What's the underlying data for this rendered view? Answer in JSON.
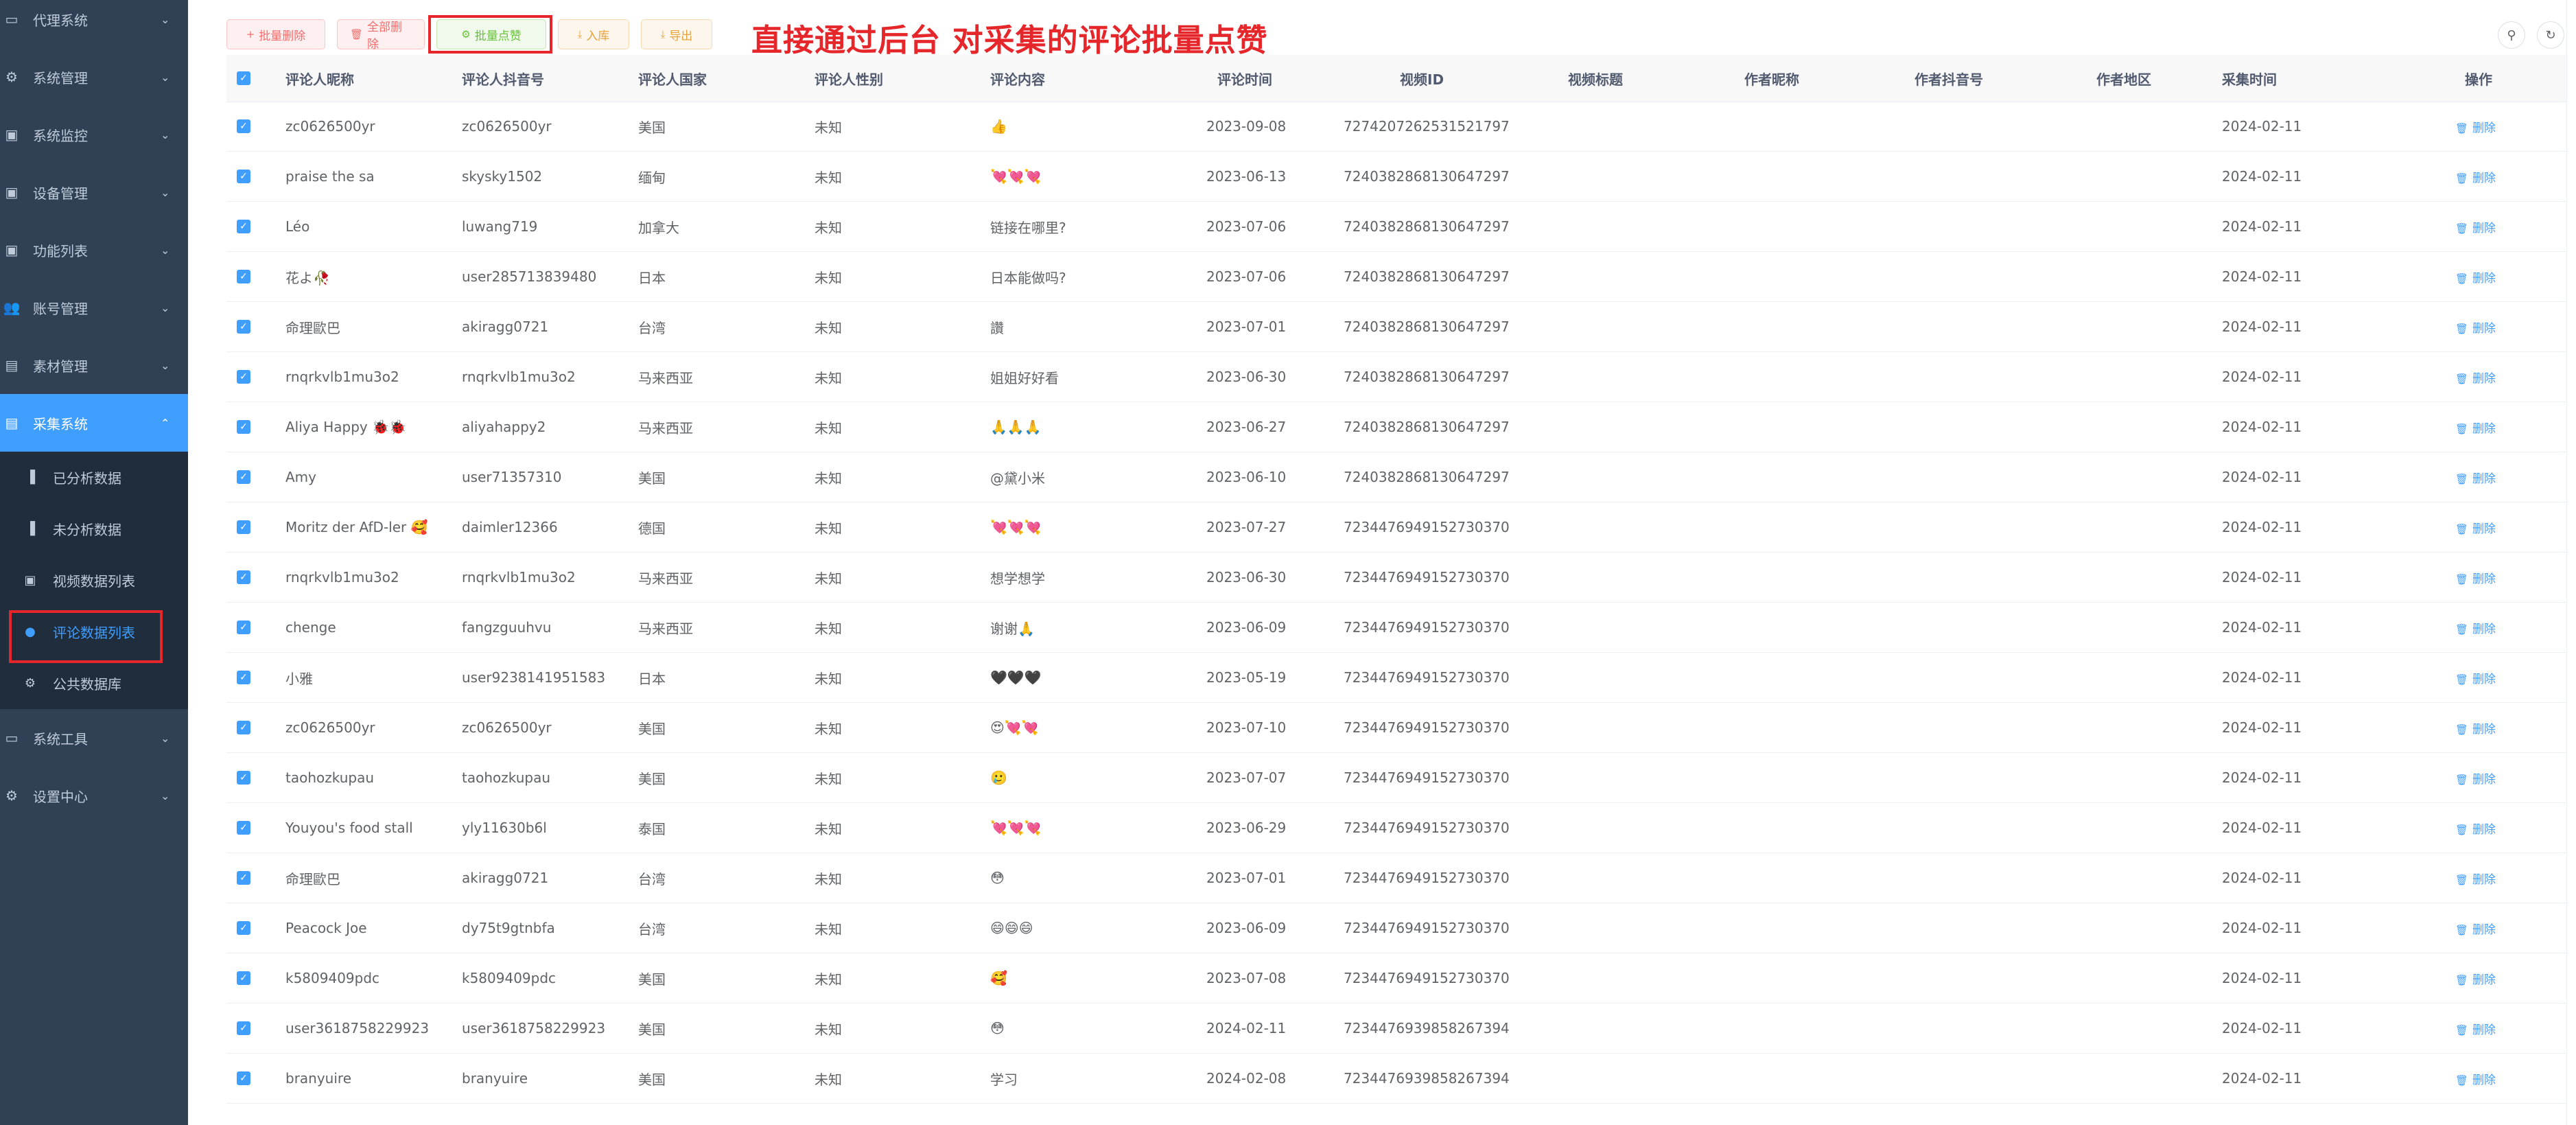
{
  "sidebar": {
    "menu": [
      {
        "label": "代理系统",
        "icon": "folder-icon",
        "glyph": "▭"
      },
      {
        "label": "系统管理",
        "icon": "gear-icon",
        "glyph": "⚙"
      },
      {
        "label": "系统监控",
        "icon": "monitor-icon",
        "glyph": "▣"
      },
      {
        "label": "设备管理",
        "icon": "monitor-icon",
        "glyph": "▣"
      },
      {
        "label": "功能列表",
        "icon": "monitor-icon",
        "glyph": "▣"
      },
      {
        "label": "账号管理",
        "icon": "users-icon",
        "glyph": "👥"
      },
      {
        "label": "素材管理",
        "icon": "document-icon",
        "glyph": "▤"
      },
      {
        "label": "采集系统",
        "icon": "document-icon",
        "glyph": "▤"
      }
    ],
    "submenu": [
      {
        "label": "已分析数据",
        "icon": "bar-chart-icon",
        "glyph": "▐"
      },
      {
        "label": "未分析数据",
        "icon": "bar-chart-icon",
        "glyph": "▐"
      },
      {
        "label": "视频数据列表",
        "icon": "monitor-icon",
        "glyph": "▣"
      },
      {
        "label": "评论数据列表",
        "icon": "chat-icon",
        "glyph": "●"
      },
      {
        "label": "公共数据库",
        "icon": "gear-icon",
        "glyph": "⚙"
      }
    ],
    "menu_bottom": [
      {
        "label": "系统工具",
        "icon": "toolbox-icon",
        "glyph": "▭"
      },
      {
        "label": "设置中心",
        "icon": "gear-icon",
        "glyph": "⚙"
      }
    ],
    "arrow_glyph": "⌄",
    "arrow_up_glyph": "⌃"
  },
  "toolbar": {
    "buttons": [
      {
        "label": "批量删除",
        "glyph": "+"
      },
      {
        "label": "全部删除",
        "glyph": "🗑"
      },
      {
        "label": "批量点赞",
        "glyph": "⚙"
      },
      {
        "label": "入库",
        "glyph": "⤓"
      },
      {
        "label": "导出",
        "glyph": "⤓"
      }
    ]
  },
  "annotation": "直接通过后台 对采集的评论批量点赞",
  "top_right": {
    "search_glyph": "⚲",
    "refresh_glyph": "↻"
  },
  "table": {
    "checkbox_glyph": "✓",
    "headers": {
      "name": "评论人昵称",
      "douyin": "评论人抖音号",
      "country": "评论人国家",
      "gender": "评论人性别",
      "content": "评论内容",
      "time": "评论时间",
      "video_id": "视频ID",
      "video_title": "视频标题",
      "author_name": "作者昵称",
      "author_douyin": "作者抖音号",
      "author_region": "作者地区",
      "collect_time": "采集时间",
      "op": "操作"
    },
    "delete_label": "删除",
    "delete_glyph": "🗑",
    "rows": [
      {
        "name": "zc0626500yr",
        "douyin": "zc0626500yr",
        "country": "美国",
        "gender": "未知",
        "content": "👍",
        "time": "2023-09-08",
        "video_id": "7274207262531521797",
        "collect": "2024-02-11"
      },
      {
        "name": "praise the sa",
        "douyin": "skysky1502",
        "country": "缅甸",
        "gender": "未知",
        "content": "💘💘💘",
        "time": "2023-06-13",
        "video_id": "7240382868130647297",
        "collect": "2024-02-11"
      },
      {
        "name": "Léo",
        "douyin": "luwang719",
        "country": "加拿大",
        "gender": "未知",
        "content": "链接在哪里?",
        "time": "2023-07-06",
        "video_id": "7240382868130647297",
        "collect": "2024-02-11"
      },
      {
        "name": "花よ🥀",
        "douyin": "user285713839480",
        "country": "日本",
        "gender": "未知",
        "content": "日本能做吗?",
        "time": "2023-07-06",
        "video_id": "7240382868130647297",
        "collect": "2024-02-11"
      },
      {
        "name": "命理歐巴",
        "douyin": "akiragg0721",
        "country": "台湾",
        "gender": "未知",
        "content": "讚",
        "time": "2023-07-01",
        "video_id": "7240382868130647297",
        "collect": "2024-02-11"
      },
      {
        "name": "rnqrkvlb1mu3o2",
        "douyin": "rnqrkvlb1mu3o2",
        "country": "马来西亚",
        "gender": "未知",
        "content": "姐姐好好看",
        "time": "2023-06-30",
        "video_id": "7240382868130647297",
        "collect": "2024-02-11"
      },
      {
        "name": "Aliya Happy 🐞🐞",
        "douyin": "aliyahappy2",
        "country": "马来西亚",
        "gender": "未知",
        "content": "🙏🙏🙏",
        "time": "2023-06-27",
        "video_id": "7240382868130647297",
        "collect": "2024-02-11"
      },
      {
        "name": "Amy",
        "douyin": "user71357310",
        "country": "美国",
        "gender": "未知",
        "content": "@黛小米",
        "time": "2023-06-10",
        "video_id": "7240382868130647297",
        "collect": "2024-02-11"
      },
      {
        "name": "Moritz der AfD-ler 🥰",
        "douyin": "daimler12366",
        "country": "德国",
        "gender": "未知",
        "content": "💘💘💘",
        "time": "2023-07-27",
        "video_id": "7234476949152730370",
        "collect": "2024-02-11"
      },
      {
        "name": "rnqrkvlb1mu3o2",
        "douyin": "rnqrkvlb1mu3o2",
        "country": "马来西亚",
        "gender": "未知",
        "content": "想学想学",
        "time": "2023-06-30",
        "video_id": "7234476949152730370",
        "collect": "2024-02-11"
      },
      {
        "name": "chenge",
        "douyin": "fangzguuhvu",
        "country": "马来西亚",
        "gender": "未知",
        "content": "谢谢🙏",
        "time": "2023-06-09",
        "video_id": "7234476949152730370",
        "collect": "2024-02-11"
      },
      {
        "name": "小雅",
        "douyin": "user9238141951583",
        "country": "日本",
        "gender": "未知",
        "content": "🖤🖤🖤",
        "time": "2023-05-19",
        "video_id": "7234476949152730370",
        "collect": "2024-02-11"
      },
      {
        "name": "zc0626500yr",
        "douyin": "zc0626500yr",
        "country": "美国",
        "gender": "未知",
        "content": "😍💘💘",
        "time": "2023-07-10",
        "video_id": "7234476949152730370",
        "collect": "2024-02-11"
      },
      {
        "name": "taohozkupau",
        "douyin": "taohozkupau",
        "country": "美国",
        "gender": "未知",
        "content": "🥲",
        "time": "2023-07-07",
        "video_id": "7234476949152730370",
        "collect": "2024-02-11"
      },
      {
        "name": "Youyou's food stall",
        "douyin": "yly11630b6l",
        "country": "泰国",
        "gender": "未知",
        "content": "💘💘💘",
        "time": "2023-06-29",
        "video_id": "7234476949152730370",
        "collect": "2024-02-11"
      },
      {
        "name": "命理歐巴",
        "douyin": "akiragg0721",
        "country": "台湾",
        "gender": "未知",
        "content": "😳",
        "time": "2023-07-01",
        "video_id": "7234476949152730370",
        "collect": "2024-02-11"
      },
      {
        "name": "Peacock Joe",
        "douyin": "dy75t9gtnbfa",
        "country": "台湾",
        "gender": "未知",
        "content": "😄😄😄",
        "time": "2023-06-09",
        "video_id": "7234476949152730370",
        "collect": "2024-02-11"
      },
      {
        "name": "k5809409pdc",
        "douyin": "k5809409pdc",
        "country": "美国",
        "gender": "未知",
        "content": "🥰",
        "time": "2023-07-08",
        "video_id": "7234476949152730370",
        "collect": "2024-02-11"
      },
      {
        "name": "user3618758229923",
        "douyin": "user3618758229923",
        "country": "美国",
        "gender": "未知",
        "content": "😳",
        "time": "2024-02-11",
        "video_id": "7234476939858267394",
        "collect": "2024-02-11"
      },
      {
        "name": "branyuire",
        "douyin": "branyuire",
        "country": "美国",
        "gender": "未知",
        "content": "学习",
        "time": "2024-02-08",
        "video_id": "7234476939858267394",
        "collect": "2024-02-11"
      }
    ]
  }
}
